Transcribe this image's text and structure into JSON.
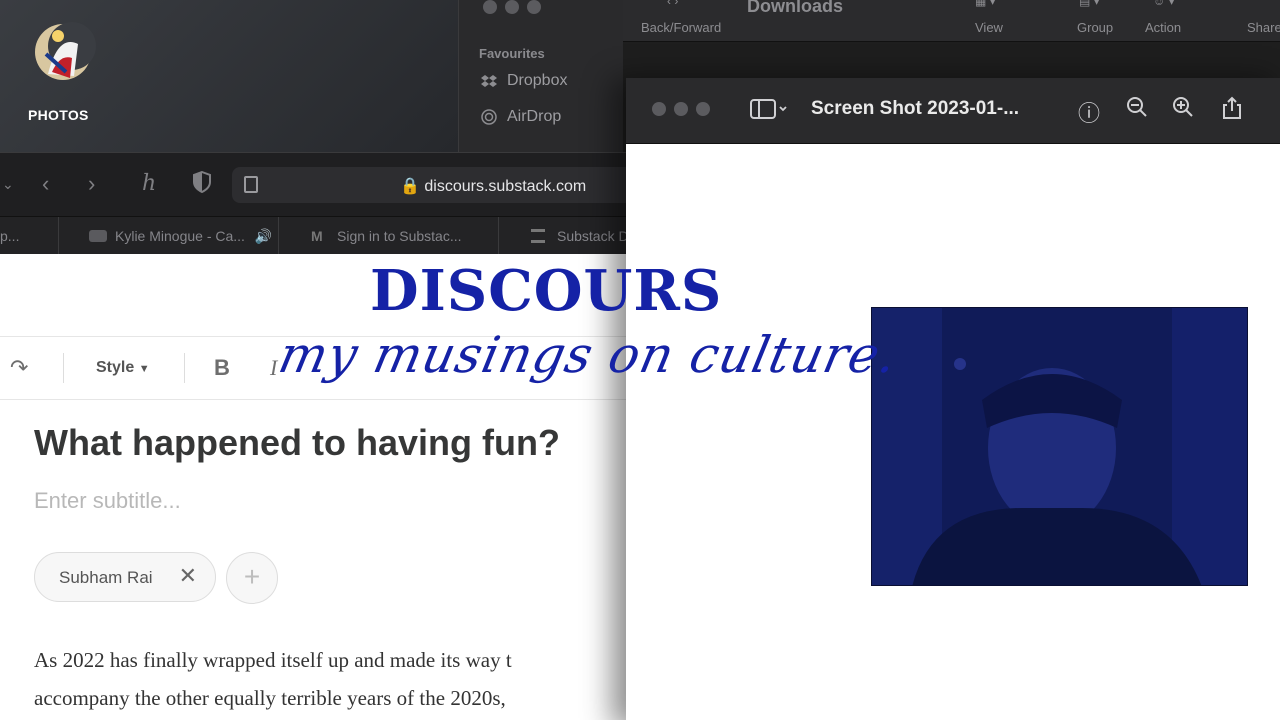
{
  "photos": {
    "label": "PHOTOS"
  },
  "finder": {
    "sidebar_section": "Favourites",
    "sidebar_items": [
      {
        "label": "Dropbox",
        "icon": "dropbox-icon"
      },
      {
        "label": "AirDrop",
        "icon": "airdrop-icon"
      }
    ],
    "window_title": "Downloads",
    "toolbar_labels": [
      "Back/Forward",
      "View",
      "Group",
      "Action",
      "Share"
    ]
  },
  "safari": {
    "url": "discours.substack.com",
    "tabs": [
      "p...",
      "Kylie Minogue - Ca...",
      "Sign in to Substac...",
      "Substack D"
    ]
  },
  "editor": {
    "style_label": "Style",
    "title": "What happened to having fun?",
    "subtitle_placeholder": "Enter subtitle...",
    "author": "Subham Rai",
    "add_symbol": "+",
    "body_lines": [
      "As 2022 has finally wrapped itself up and made its way t",
      "accompany the other equally terrible years of the 2020s,"
    ]
  },
  "preview": {
    "title": "Screen Shot 2023-01-..."
  },
  "brand": {
    "title": "DISCOURS",
    "tagline": "my musings on culture.",
    "accent_color": "#1522a6"
  }
}
